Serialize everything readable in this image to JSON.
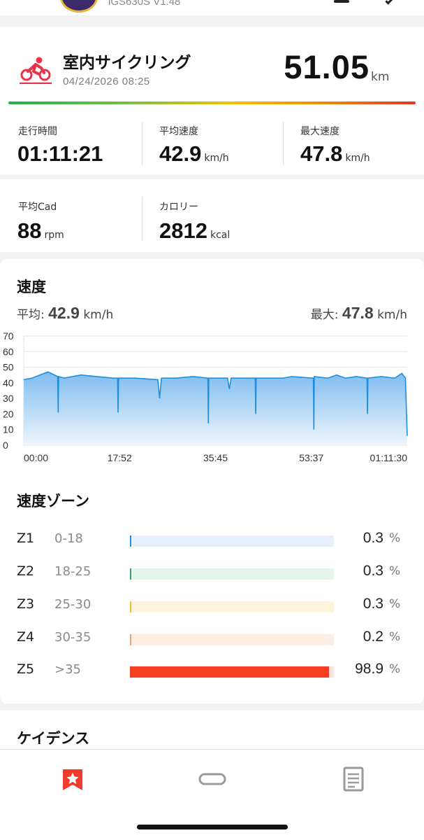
{
  "header": {
    "device": "iGS630S V1.48"
  },
  "activity": {
    "title": "室内サイクリング",
    "datetime": "04/24/2026 08:25",
    "distance": "51.05",
    "distance_unit": "km",
    "icon": "indoor-cycling-icon"
  },
  "stats": {
    "time_label": "走行時間",
    "time_value": "01:11:21",
    "avg_speed_label": "平均速度",
    "avg_speed_value": "42.9",
    "avg_speed_unit": "km/h",
    "max_speed_label": "最大速度",
    "max_speed_value": "47.8",
    "max_speed_unit": "km/h",
    "avg_cad_label": "平均Cad",
    "avg_cad_value": "88",
    "avg_cad_unit": "rpm",
    "calories_label": "カロリー",
    "calories_value": "2812",
    "calories_unit": "kcal"
  },
  "speed": {
    "title": "速度",
    "avg_label": "平均:",
    "avg_value": "42.9",
    "avg_unit": "km/h",
    "max_label": "最大:",
    "max_value": "47.8",
    "max_unit": "km/h"
  },
  "chart_data": {
    "type": "area",
    "y_ticks": [
      "70",
      "60",
      "50",
      "40",
      "30",
      "20",
      "10",
      "0"
    ],
    "x_ticks": [
      "00:00",
      "17:52",
      "35:45",
      "53:37",
      "01:11:30"
    ],
    "ylim": [
      0,
      70
    ],
    "xlim": [
      0,
      4290
    ],
    "grid": true,
    "x_seconds": [
      0,
      90,
      270,
      380,
      385,
      390,
      450,
      640,
      1000,
      1050,
      1055,
      1060,
      1250,
      1500,
      1520,
      1540,
      1700,
      1900,
      2060,
      2065,
      2070,
      2280,
      2300,
      2320,
      2520,
      2590,
      2595,
      2600,
      2800,
      2900,
      3000,
      3240,
      3245,
      3250,
      3400,
      3500,
      3600,
      3720,
      3840,
      3845,
      3850,
      4000,
      4150,
      4230,
      4270,
      4290
    ],
    "speed_kmh": [
      42,
      43,
      47,
      44,
      21,
      44,
      43,
      45,
      43,
      43,
      21,
      43,
      43,
      42,
      30,
      43,
      43,
      44,
      43,
      14,
      43,
      43,
      36,
      43,
      43,
      43,
      20,
      43,
      43,
      43,
      44,
      43,
      10,
      44,
      43,
      45,
      43,
      44,
      43,
      20,
      43,
      44,
      43,
      46,
      43,
      6
    ],
    "color": "#1e8fdf"
  },
  "zones": {
    "title": "速度ゾーン",
    "items": [
      {
        "name": "Z1",
        "range": "0-18",
        "pct": "0.3",
        "fraction": 0.003,
        "color": "#2a8fd8",
        "track": "#e6f1fb"
      },
      {
        "name": "Z2",
        "range": "18-25",
        "pct": "0.3",
        "fraction": 0.003,
        "color": "#33a85a",
        "track": "#e6f5ea"
      },
      {
        "name": "Z3",
        "range": "25-30",
        "pct": "0.3",
        "fraction": 0.003,
        "color": "#f1be2a",
        "track": "#fdf4dc"
      },
      {
        "name": "Z4",
        "range": "30-35",
        "pct": "0.2",
        "fraction": 0.002,
        "color": "#f2a36c",
        "track": "#fdeee3"
      },
      {
        "name": "Z5",
        "range": ">35",
        "pct": "98.9",
        "fraction": 0.989,
        "color": "#f33f22",
        "track": "#fde3de"
      }
    ],
    "pct_symbol": "%"
  },
  "cadence": {
    "title": "ケイデンス"
  },
  "nav": {
    "items": [
      "bookmark-star-icon",
      "link-icon",
      "document-icon"
    ],
    "active_color": "#f03b2d"
  }
}
